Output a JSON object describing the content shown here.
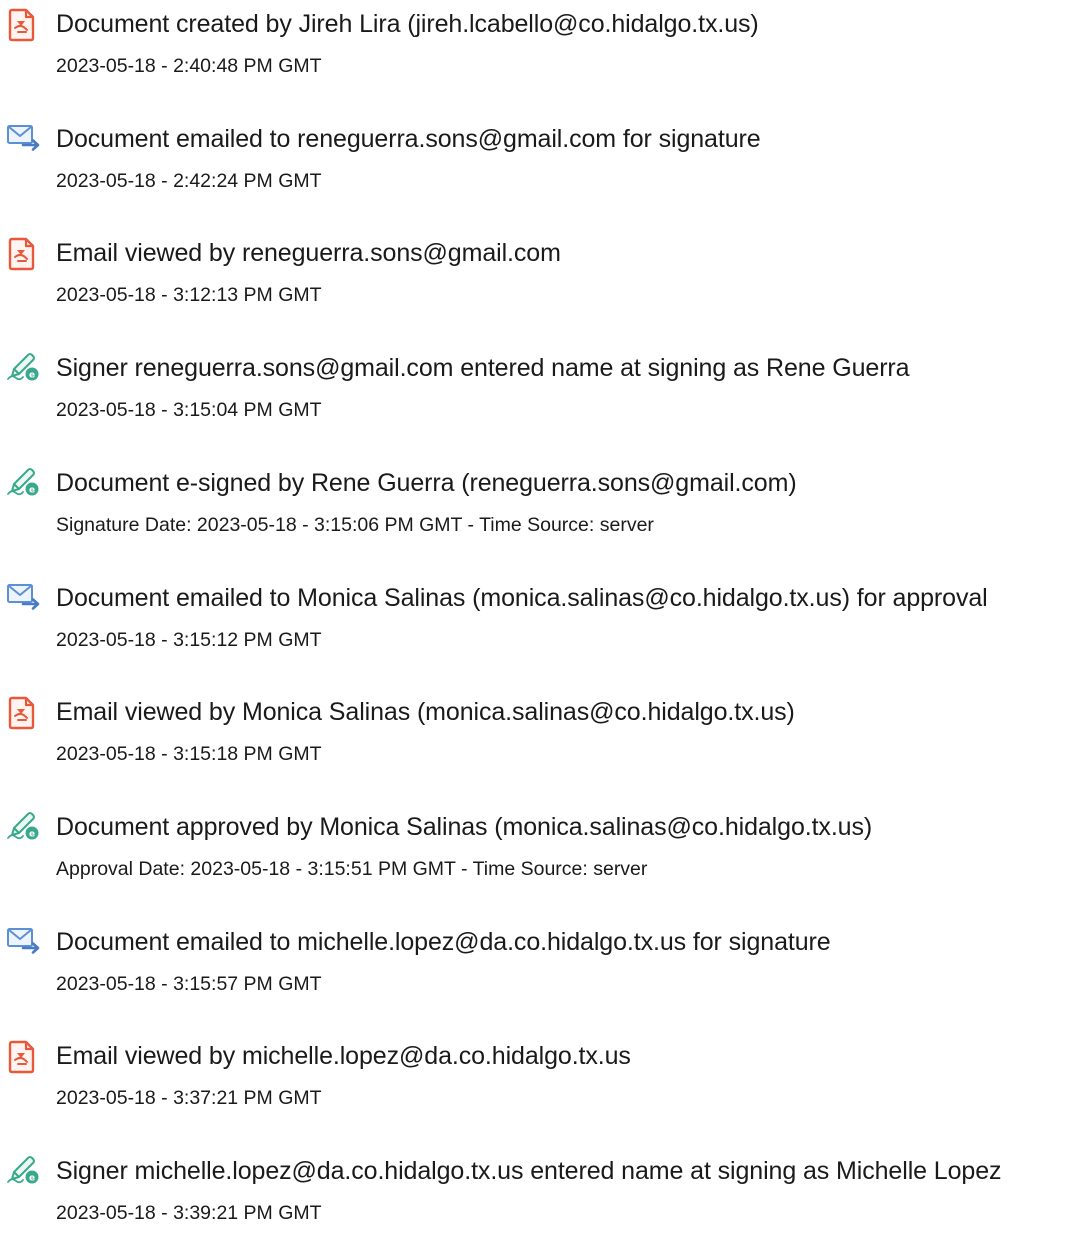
{
  "events": [
    {
      "icon": "document-icon",
      "title": "Document created by Jireh Lira (jireh.lcabello@co.hidalgo.tx.us)",
      "date": "2023-05-18 - 2:40:48 PM GMT"
    },
    {
      "icon": "email-send-icon",
      "title": "Document emailed to reneguerra.sons@gmail.com for signature",
      "date": "2023-05-18 - 2:42:24 PM GMT"
    },
    {
      "icon": "document-icon",
      "title": "Email viewed by reneguerra.sons@gmail.com",
      "date": "2023-05-18 - 3:12:13 PM GMT"
    },
    {
      "icon": "esign-pen-icon",
      "title": "Signer reneguerra.sons@gmail.com entered name at signing as Rene Guerra",
      "date": "2023-05-18 - 3:15:04 PM GMT"
    },
    {
      "icon": "esign-pen-icon",
      "title": "Document e-signed by Rene Guerra (reneguerra.sons@gmail.com)",
      "date": "Signature Date: 2023-05-18 - 3:15:06 PM GMT - Time Source: server"
    },
    {
      "icon": "email-send-icon",
      "title": "Document emailed to Monica Salinas (monica.salinas@co.hidalgo.tx.us) for approval",
      "date": "2023-05-18 - 3:15:12 PM GMT"
    },
    {
      "icon": "document-icon",
      "title": "Email viewed by Monica Salinas (monica.salinas@co.hidalgo.tx.us)",
      "date": "2023-05-18 - 3:15:18 PM GMT"
    },
    {
      "icon": "esign-pen-icon",
      "title": "Document approved by Monica Salinas (monica.salinas@co.hidalgo.tx.us)",
      "date": "Approval Date: 2023-05-18 - 3:15:51 PM GMT - Time Source: server"
    },
    {
      "icon": "email-send-icon",
      "title": "Document emailed to michelle.lopez@da.co.hidalgo.tx.us for signature",
      "date": "2023-05-18 - 3:15:57 PM GMT"
    },
    {
      "icon": "document-icon",
      "title": "Email viewed by michelle.lopez@da.co.hidalgo.tx.us",
      "date": "2023-05-18 - 3:37:21 PM GMT"
    },
    {
      "icon": "esign-pen-icon",
      "title": "Signer michelle.lopez@da.co.hidalgo.tx.us entered name at signing as Michelle Lopez",
      "date": "2023-05-18 - 3:39:21 PM GMT"
    }
  ],
  "colors": {
    "document_icon": "#e8593c",
    "email_icon": "#5b8fd6",
    "esign_icon": "#3aa88c",
    "text": "#1a1a1a"
  }
}
